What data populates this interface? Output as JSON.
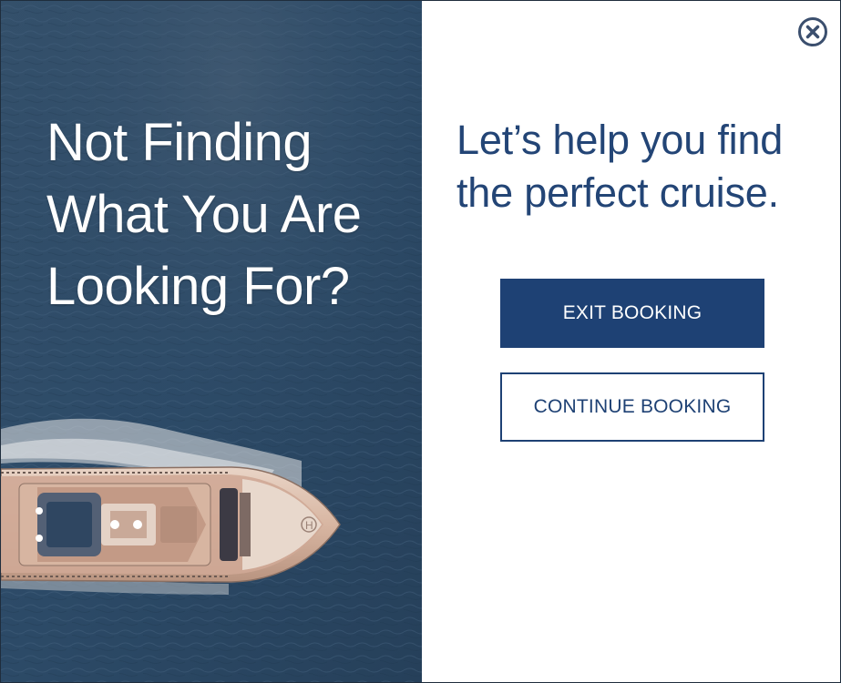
{
  "left_panel": {
    "image": "cruise-ship-aerial-ocean",
    "headline": {
      "line1": "Not Finding",
      "line2": "What You Are",
      "line3": "Looking For?"
    }
  },
  "right_panel": {
    "close_icon": "close-icon",
    "subheading": {
      "line1": "Let’s help you find",
      "line2": "the perfect cruise."
    },
    "exit_button_label": "EXIT BOOKING",
    "continue_button_label": "CONTINUE BOOKING"
  },
  "colors": {
    "brand_navy": "#1e4174",
    "heading_blue": "#234576",
    "ocean": "#2d4a66",
    "white": "#ffffff"
  }
}
